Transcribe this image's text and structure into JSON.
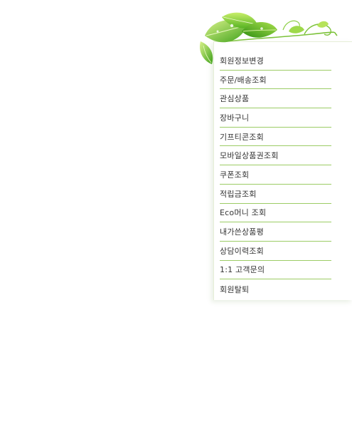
{
  "colors": {
    "divider": "#9ccc65",
    "text": "#333333",
    "leaf_dark": "#4caf1e",
    "leaf_light": "#b6e35a"
  },
  "decoration": {
    "icon": "green-leaves-vine-icon"
  },
  "menu": {
    "items": [
      {
        "label": "회원정보변경"
      },
      {
        "label": "주문/배송조회"
      },
      {
        "label": "관심상품"
      },
      {
        "label": "장바구니"
      },
      {
        "label": "기프티콘조회"
      },
      {
        "label": "모바일상품권조회"
      },
      {
        "label": "쿠폰조회"
      },
      {
        "label": "적립금조회"
      },
      {
        "label": "Eco머니 조회"
      },
      {
        "label": "내가쓴상품평"
      },
      {
        "label": "상담이력조회"
      },
      {
        "label": "1:1 고객문의"
      },
      {
        "label": "회원탈퇴"
      }
    ]
  }
}
